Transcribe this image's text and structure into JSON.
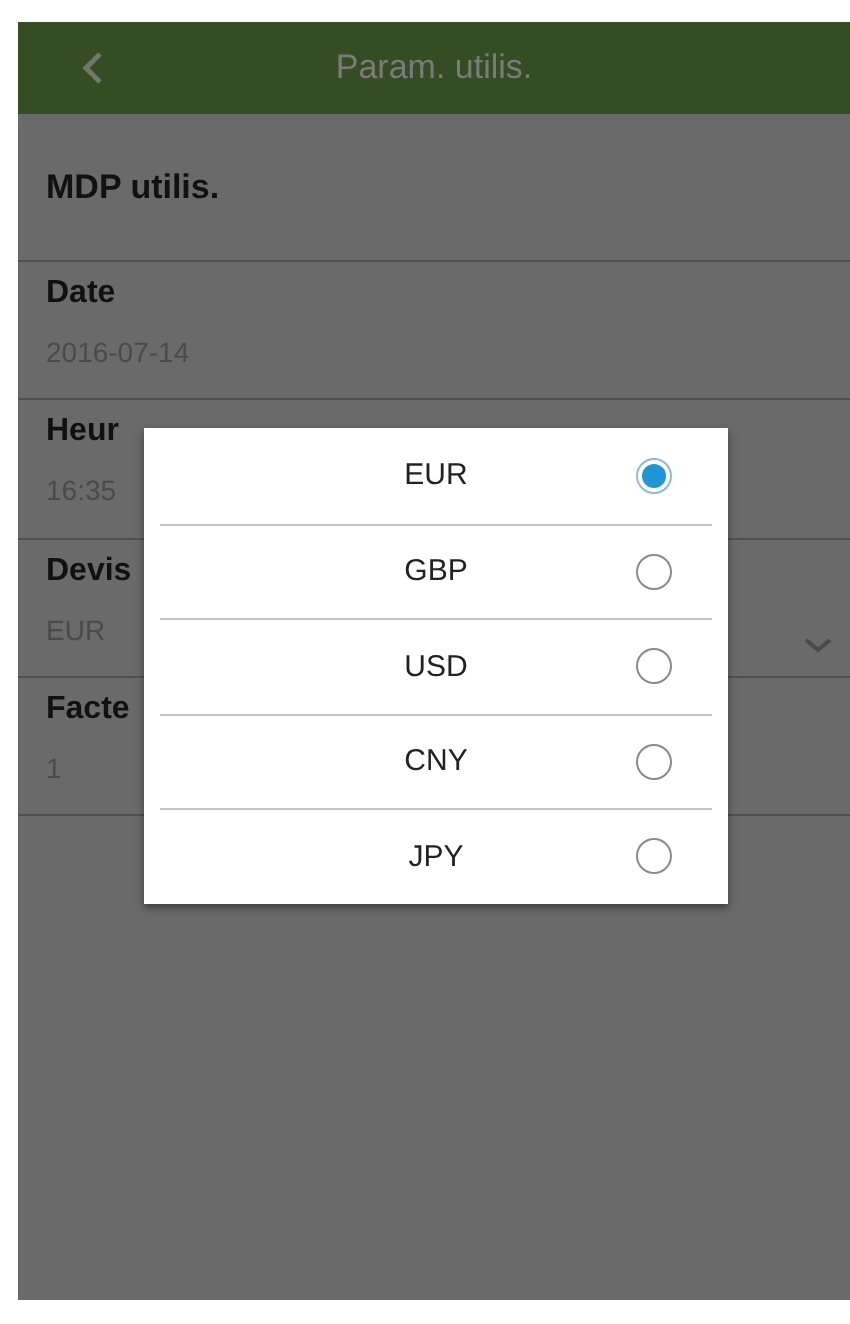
{
  "header": {
    "title": "Param. utilis."
  },
  "fields": [
    {
      "kind": "plain",
      "label": "MDP utilis."
    },
    {
      "kind": "value",
      "label": "Date",
      "value": "2016-07-14"
    },
    {
      "kind": "value",
      "label": "Heur",
      "value": "16:35"
    },
    {
      "kind": "dropdown",
      "label": "Devis",
      "value": "EUR"
    },
    {
      "kind": "value",
      "label": "Facte",
      "value": "1"
    }
  ],
  "dialog": {
    "options": [
      {
        "label": "EUR",
        "selected": true
      },
      {
        "label": "GBP",
        "selected": false
      },
      {
        "label": "USD",
        "selected": false
      },
      {
        "label": "CNY",
        "selected": false
      },
      {
        "label": "JPY",
        "selected": false
      }
    ]
  }
}
